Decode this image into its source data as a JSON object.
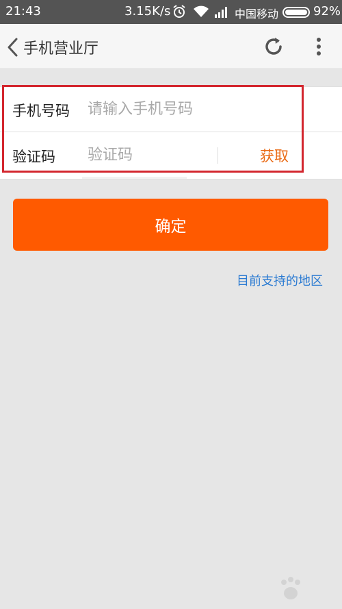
{
  "status_bar": {
    "time": "21:43",
    "speed": "3.15K/s",
    "carrier": "中国移动",
    "battery": "92%",
    "icons": [
      "alarm-icon",
      "wifi-icon",
      "signal-icon",
      "battery-icon"
    ]
  },
  "header": {
    "title": "手机营业厅",
    "icons": [
      "back-icon",
      "refresh-icon",
      "more-icon"
    ]
  },
  "form": {
    "phone_label": "手机号码",
    "phone_placeholder": "请输入手机号码",
    "code_label": "验证码",
    "code_placeholder": "验证码",
    "get_code_label": "获取"
  },
  "confirm_label": "确定",
  "regions_link": "目前支持的地区",
  "colors": {
    "accent": "#ff5a00",
    "link": "#2a7ad2",
    "get_code": "#ea6a14",
    "highlight": "#d3262e",
    "status_bar": "#545454"
  }
}
